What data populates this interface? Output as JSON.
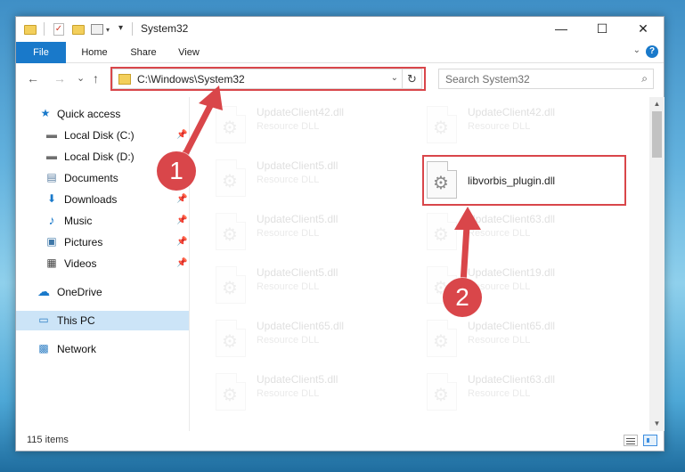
{
  "window": {
    "title": "System32",
    "controls": {
      "minimize": "—",
      "maximize": "☐",
      "close": "✕"
    },
    "quick_access_toolbar": {
      "customize": "▾",
      "dropdown": "▾",
      "check_glyph": "✓"
    }
  },
  "ribbon": {
    "tabs": [
      "File",
      "Home",
      "Share",
      "View"
    ],
    "expand_glyph": "⌄",
    "help_glyph": "?"
  },
  "navigation": {
    "back": "←",
    "forward": "→",
    "recent": "⌄",
    "up": "↑",
    "address": "C:\\Windows\\System32",
    "address_dropdown": "⌄",
    "refresh": "↻",
    "search_placeholder": "Search System32",
    "search_glyph": "⌕"
  },
  "sidebar": {
    "items": [
      {
        "label": "Quick access",
        "icon": "star-icon",
        "glyph": "★",
        "color": "#1979ca"
      },
      {
        "label": "Local Disk (C:)",
        "icon": "drive-icon",
        "glyph": "▬",
        "color": "#6f6f6f",
        "pin": "📌"
      },
      {
        "label": "Local Disk (D:)",
        "icon": "drive-icon",
        "glyph": "▬",
        "color": "#6f6f6f",
        "pin": "📌"
      },
      {
        "label": "Documents",
        "icon": "documents-icon",
        "glyph": "▤",
        "color": "#5b7fa3",
        "pin": "📌"
      },
      {
        "label": "Downloads",
        "icon": "download-icon",
        "glyph": "⬇",
        "color": "#1979ca",
        "pin": "📌"
      },
      {
        "label": "Music",
        "icon": "music-icon",
        "glyph": "♪",
        "color": "#1979ca",
        "pin": "📌"
      },
      {
        "label": "Pictures",
        "icon": "pictures-icon",
        "glyph": "▣",
        "color": "#3f78a8",
        "pin": "📌"
      },
      {
        "label": "Videos",
        "icon": "videos-icon",
        "glyph": "▦",
        "color": "#444444",
        "pin": "📌"
      },
      {
        "label": "OneDrive",
        "icon": "cloud-icon",
        "glyph": "☁",
        "color": "#1979ca"
      },
      {
        "label": "This PC",
        "icon": "computer-icon",
        "glyph": "▭",
        "color": "#2d7ec4",
        "selected": true
      },
      {
        "label": "Network",
        "icon": "network-icon",
        "glyph": "▩",
        "color": "#2d7ec4"
      }
    ]
  },
  "files": [
    {
      "name": "UpdateClient42.dll",
      "type": "Resource DLL",
      "faded": true
    },
    {
      "name": "UpdateClient42.dll",
      "type": "Resource DLL",
      "faded": true
    },
    {
      "name": "UpdateClient5.dll",
      "type": "Resource DLL",
      "faded": true
    },
    {
      "name": "libvorbis_plugin.dll",
      "type": "",
      "faded": false
    },
    {
      "name": "UpdateClient5.dll",
      "type": "Resource DLL",
      "faded": true
    },
    {
      "name": "UpdateClient63.dll",
      "type": "Resource DLL",
      "faded": true
    },
    {
      "name": "UpdateClient5.dll",
      "type": "Resource DLL",
      "faded": true
    },
    {
      "name": "UpdateClient19.dll",
      "type": "Resource DLL",
      "faded": true
    },
    {
      "name": "UpdateClient65.dll",
      "type": "Resource DLL",
      "faded": true
    },
    {
      "name": "UpdateClient65.dll",
      "type": "Resource DLL",
      "faded": true
    },
    {
      "name": "UpdateClient5.dll",
      "type": "Resource DLL",
      "faded": true
    },
    {
      "name": "UpdateClient63.dll",
      "type": "Resource DLL",
      "faded": true
    }
  ],
  "file_gear_glyph": "⚙",
  "scrollbar": {
    "up": "▲",
    "down": "▼"
  },
  "status": {
    "items": "115 items"
  },
  "annotations": {
    "step1": "1",
    "step2": "2",
    "color": "#d9464a"
  }
}
